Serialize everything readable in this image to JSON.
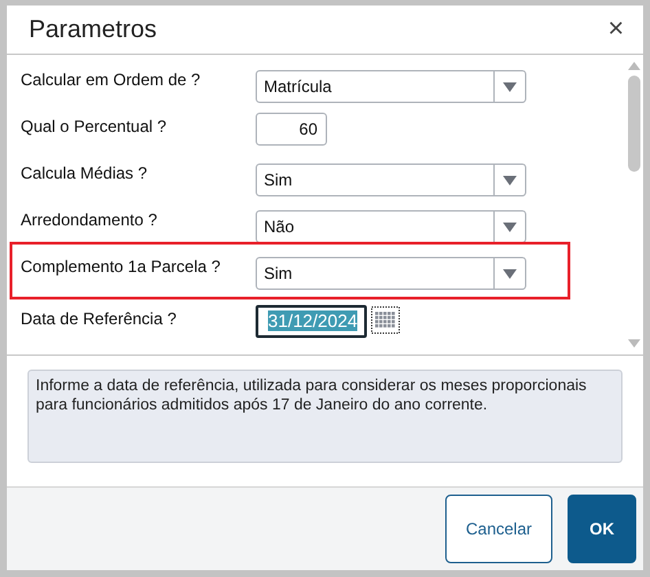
{
  "window": {
    "title": "Parametros",
    "close": "×"
  },
  "parameters": [
    {
      "label": "Calcular em Ordem de ?",
      "kind": "select",
      "value": "Matrícula",
      "highlighted": false,
      "focused": false
    },
    {
      "label": "Qual o Percentual ?",
      "kind": "number",
      "value": "60",
      "highlighted": false,
      "focused": false
    },
    {
      "label": "Calcula Médias ?",
      "kind": "select",
      "value": "Sim",
      "highlighted": false,
      "focused": false
    },
    {
      "label": "Arredondamento ?",
      "kind": "select",
      "value": "Não",
      "highlighted": false,
      "focused": false
    },
    {
      "label": "Complemento 1a Parcela ?",
      "kind": "select",
      "value": "Sim",
      "highlighted": true,
      "focused": false
    },
    {
      "label": "Data de Referência ?",
      "kind": "date",
      "value": "31/12/2024",
      "highlighted": false,
      "focused": true
    }
  ],
  "help_text": "Informe a data de referência, utilizada para considerar os meses proporcionais para funcionários admitidos após 17 de Janeiro do ano corrente.",
  "buttons": [
    {
      "label": "Cancelar",
      "kind": "secondary"
    },
    {
      "label": "OK",
      "kind": "primary"
    }
  ]
}
